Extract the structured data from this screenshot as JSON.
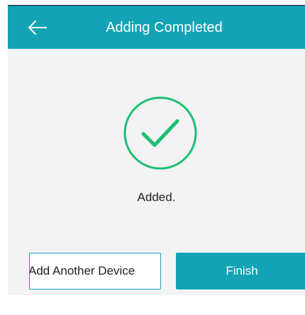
{
  "header": {
    "title": "Adding Completed",
    "back_icon": "arrow-left-icon"
  },
  "status": {
    "icon": "check-circle-icon",
    "text": "Added."
  },
  "buttons": {
    "add_another_label": "Add Another Device",
    "finish_label": "Finish"
  },
  "colors": {
    "header_bg": "#13a3b5",
    "success_green": "#1dbf73",
    "page_bg": "#f3f3f3"
  }
}
